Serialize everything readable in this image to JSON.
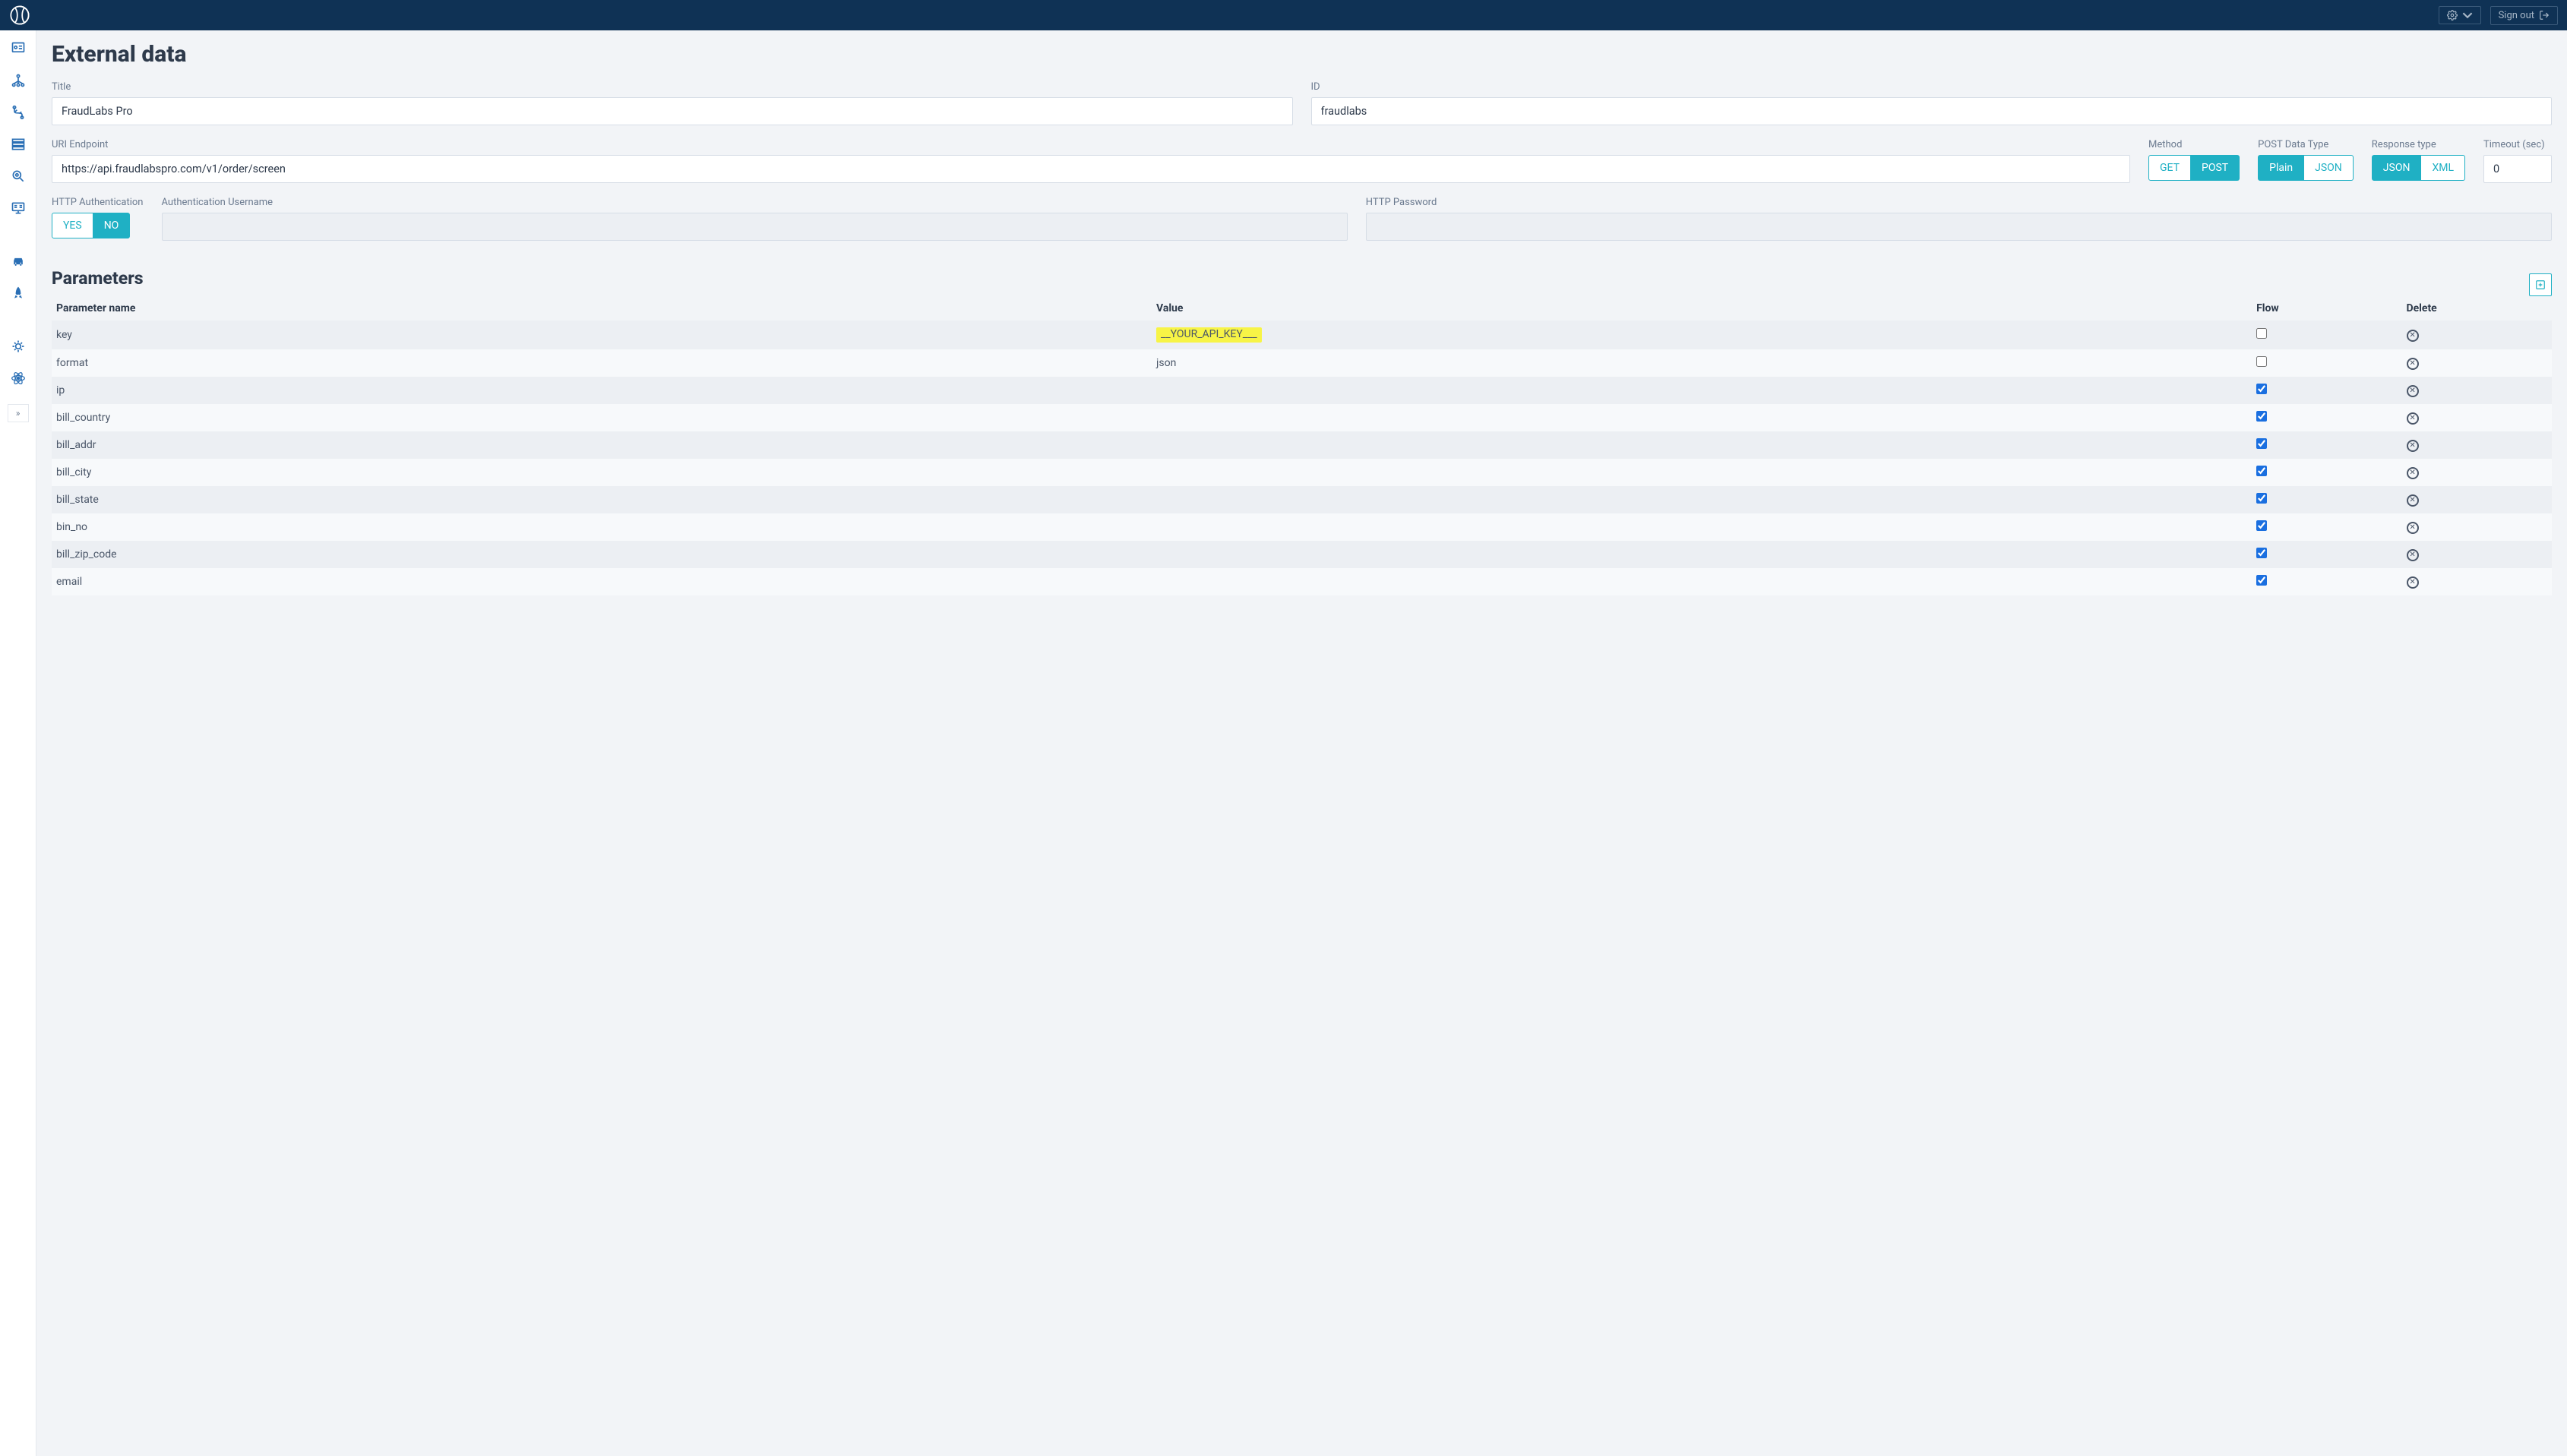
{
  "header": {
    "settings_label": "",
    "signout_label": "Sign out"
  },
  "page": {
    "title": "External data",
    "form": {
      "title_label": "Title",
      "title_value": "FraudLabs Pro",
      "id_label": "ID",
      "id_value": "fraudlabs",
      "uri_label": "URI Endpoint",
      "uri_value": "https://api.fraudlabspro.com/v1/order/screen",
      "method_label": "Method",
      "method_get": "GET",
      "method_post": "POST",
      "postdata_label": "POST Data Type",
      "postdata_plain": "Plain",
      "postdata_json": "JSON",
      "response_label": "Response type",
      "response_json": "JSON",
      "response_xml": "XML",
      "timeout_label": "Timeout (sec)",
      "timeout_value": "0",
      "httpauth_label": "HTTP Authentication",
      "httpauth_yes": "YES",
      "httpauth_no": "NO",
      "authuser_label": "Authentication Username",
      "httppass_label": "HTTP Password"
    },
    "params": {
      "title": "Parameters",
      "col_name": "Parameter name",
      "col_value": "Value",
      "col_flow": "Flow",
      "col_delete": "Delete",
      "rows": [
        {
          "name": "key",
          "value": "__YOUR_API_KEY___",
          "flow": false,
          "highlight": true
        },
        {
          "name": "format",
          "value": "json",
          "flow": false
        },
        {
          "name": "ip",
          "value": "",
          "flow": true
        },
        {
          "name": "bill_country",
          "value": "",
          "flow": true
        },
        {
          "name": "bill_addr",
          "value": "",
          "flow": true
        },
        {
          "name": "bill_city",
          "value": "",
          "flow": true
        },
        {
          "name": "bill_state",
          "value": "",
          "flow": true
        },
        {
          "name": "bin_no",
          "value": "",
          "flow": true
        },
        {
          "name": "bill_zip_code",
          "value": "",
          "flow": true
        },
        {
          "name": "email",
          "value": "",
          "flow": true
        }
      ]
    }
  }
}
